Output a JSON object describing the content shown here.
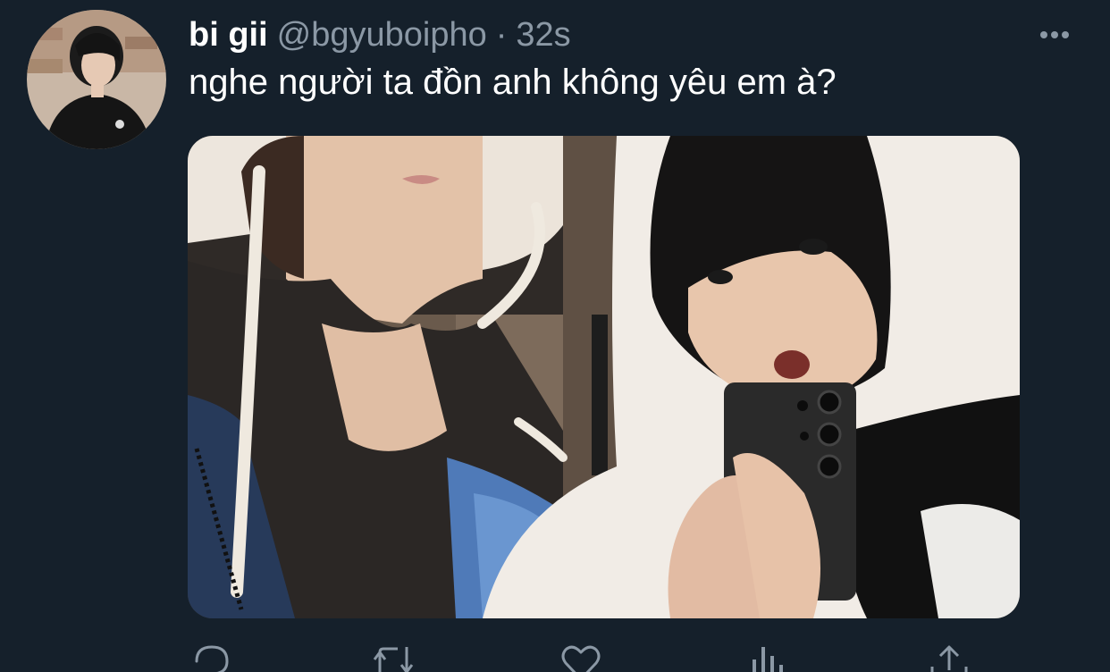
{
  "tweet": {
    "display_name": "bi gii",
    "handle": "@bgyuboipho",
    "separator": "·",
    "time": "32s",
    "text": "nghe người ta đồn anh không yêu em à?"
  },
  "icons": {
    "more": "more-horizontal-icon",
    "reply": "reply-icon",
    "retweet": "retweet-icon",
    "like": "heart-icon",
    "analytics": "analytics-icon",
    "share": "share-icon"
  },
  "colors": {
    "background": "#15202b",
    "secondary_text": "#8b98a5",
    "primary_text": "#ffffff"
  }
}
